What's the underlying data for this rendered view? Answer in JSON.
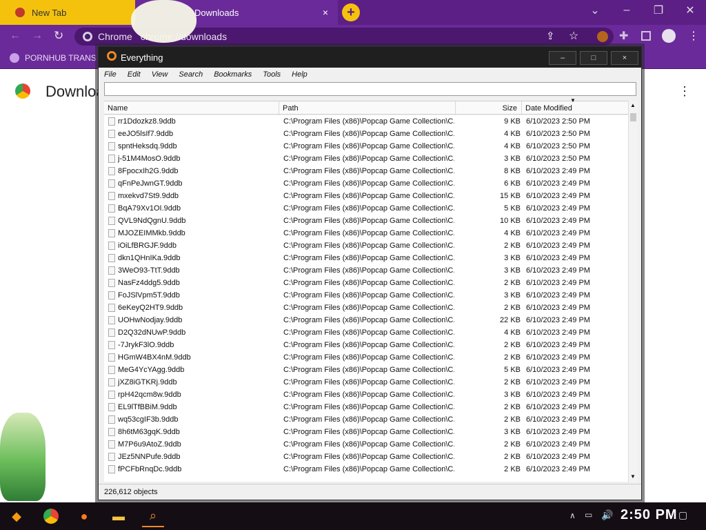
{
  "browser": {
    "tabs": [
      {
        "label": "New Tab"
      },
      {
        "label": "Downloads"
      }
    ],
    "new_tab_symbol": "+",
    "omnibox": {
      "site_label": "Chrome",
      "url_text": "chrome://downloads"
    },
    "bookmarks": [
      {
        "label": "PORNHUB TRANS"
      }
    ],
    "page_title": "Downloads",
    "colors": {
      "tabbar": "#5c1f86",
      "toolbar": "#6b2a99",
      "active_tab": "#ffffff",
      "new_tab_button": "#f4c20d"
    }
  },
  "everything": {
    "title": "Everything",
    "window_buttons": [
      "–",
      "□",
      "×"
    ],
    "menu": [
      "File",
      "Edit",
      "View",
      "Search",
      "Bookmarks",
      "Tools",
      "Help"
    ],
    "search_value": "",
    "columns": {
      "name": "Name",
      "path": "Path",
      "size": "Size",
      "date": "Date Modified"
    },
    "rows": [
      {
        "name": "rr1Ddozkz8.9ddb",
        "path": "C:\\Program Files (x86)\\Popcap Game Collection\\C...",
        "size": "9 KB",
        "date": "6/10/2023 2:50 PM"
      },
      {
        "name": "eeJO5lsIf7.9ddb",
        "path": "C:\\Program Files (x86)\\Popcap Game Collection\\C...",
        "size": "4 KB",
        "date": "6/10/2023 2:50 PM"
      },
      {
        "name": "spntHeksdq.9ddb",
        "path": "C:\\Program Files (x86)\\Popcap Game Collection\\C...",
        "size": "4 KB",
        "date": "6/10/2023 2:50 PM"
      },
      {
        "name": "j-51M4MosO.9ddb",
        "path": "C:\\Program Files (x86)\\Popcap Game Collection\\C...",
        "size": "3 KB",
        "date": "6/10/2023 2:50 PM"
      },
      {
        "name": "8FpocxIh2G.9ddb",
        "path": "C:\\Program Files (x86)\\Popcap Game Collection\\C...",
        "size": "8 KB",
        "date": "6/10/2023 2:49 PM"
      },
      {
        "name": "qFnPeJwnGT.9ddb",
        "path": "C:\\Program Files (x86)\\Popcap Game Collection\\C...",
        "size": "6 KB",
        "date": "6/10/2023 2:49 PM"
      },
      {
        "name": "mxekvd7St9.9ddb",
        "path": "C:\\Program Files (x86)\\Popcap Game Collection\\C...",
        "size": "15 KB",
        "date": "6/10/2023 2:49 PM"
      },
      {
        "name": "BqA79Xv1OI.9ddb",
        "path": "C:\\Program Files (x86)\\Popcap Game Collection\\C...",
        "size": "5 KB",
        "date": "6/10/2023 2:49 PM"
      },
      {
        "name": "QVL9NdQgnU.9ddb",
        "path": "C:\\Program Files (x86)\\Popcap Game Collection\\C...",
        "size": "10 KB",
        "date": "6/10/2023 2:49 PM"
      },
      {
        "name": "MJOZEIMMkb.9ddb",
        "path": "C:\\Program Files (x86)\\Popcap Game Collection\\C...",
        "size": "4 KB",
        "date": "6/10/2023 2:49 PM"
      },
      {
        "name": "iOiLfBRGJF.9ddb",
        "path": "C:\\Program Files (x86)\\Popcap Game Collection\\C...",
        "size": "2 KB",
        "date": "6/10/2023 2:49 PM"
      },
      {
        "name": "dkn1QHnIKa.9ddb",
        "path": "C:\\Program Files (x86)\\Popcap Game Collection\\C...",
        "size": "3 KB",
        "date": "6/10/2023 2:49 PM"
      },
      {
        "name": "3WeO93-TtT.9ddb",
        "path": "C:\\Program Files (x86)\\Popcap Game Collection\\C...",
        "size": "3 KB",
        "date": "6/10/2023 2:49 PM"
      },
      {
        "name": "NasFz4ddg5.9ddb",
        "path": "C:\\Program Files (x86)\\Popcap Game Collection\\C...",
        "size": "2 KB",
        "date": "6/10/2023 2:49 PM"
      },
      {
        "name": "FoJSlVpm5T.9ddb",
        "path": "C:\\Program Files (x86)\\Popcap Game Collection\\C...",
        "size": "3 KB",
        "date": "6/10/2023 2:49 PM"
      },
      {
        "name": "6eKeyQ2HT9.9ddb",
        "path": "C:\\Program Files (x86)\\Popcap Game Collection\\C...",
        "size": "2 KB",
        "date": "6/10/2023 2:49 PM"
      },
      {
        "name": "UOHwNodjay.9ddb",
        "path": "C:\\Program Files (x86)\\Popcap Game Collection\\C...",
        "size": "22 KB",
        "date": "6/10/2023 2:49 PM"
      },
      {
        "name": "D2Q32dNUwP.9ddb",
        "path": "C:\\Program Files (x86)\\Popcap Game Collection\\C...",
        "size": "4 KB",
        "date": "6/10/2023 2:49 PM"
      },
      {
        "name": "-7JrykF3lO.9ddb",
        "path": "C:\\Program Files (x86)\\Popcap Game Collection\\C...",
        "size": "2 KB",
        "date": "6/10/2023 2:49 PM"
      },
      {
        "name": "HGmW4BX4nM.9ddb",
        "path": "C:\\Program Files (x86)\\Popcap Game Collection\\C...",
        "size": "2 KB",
        "date": "6/10/2023 2:49 PM"
      },
      {
        "name": "MeG4YcYAgg.9ddb",
        "path": "C:\\Program Files (x86)\\Popcap Game Collection\\C...",
        "size": "5 KB",
        "date": "6/10/2023 2:49 PM"
      },
      {
        "name": "jXZ8iGTKRj.9ddb",
        "path": "C:\\Program Files (x86)\\Popcap Game Collection\\C...",
        "size": "2 KB",
        "date": "6/10/2023 2:49 PM"
      },
      {
        "name": "rpH42qcm8w.9ddb",
        "path": "C:\\Program Files (x86)\\Popcap Game Collection\\C...",
        "size": "3 KB",
        "date": "6/10/2023 2:49 PM"
      },
      {
        "name": "EL9lTfBBiM.9ddb",
        "path": "C:\\Program Files (x86)\\Popcap Game Collection\\C...",
        "size": "2 KB",
        "date": "6/10/2023 2:49 PM"
      },
      {
        "name": "wq53cgIF3b.9ddb",
        "path": "C:\\Program Files (x86)\\Popcap Game Collection\\C...",
        "size": "2 KB",
        "date": "6/10/2023 2:49 PM"
      },
      {
        "name": "8h6tM63gqK.9ddb",
        "path": "C:\\Program Files (x86)\\Popcap Game Collection\\C...",
        "size": "3 KB",
        "date": "6/10/2023 2:49 PM"
      },
      {
        "name": "M7P6u9AtoZ.9ddb",
        "path": "C:\\Program Files (x86)\\Popcap Game Collection\\C...",
        "size": "2 KB",
        "date": "6/10/2023 2:49 PM"
      },
      {
        "name": "JEz5NNPufe.9ddb",
        "path": "C:\\Program Files (x86)\\Popcap Game Collection\\C...",
        "size": "2 KB",
        "date": "6/10/2023 2:49 PM"
      },
      {
        "name": "fPCFbRnqDc.9ddb",
        "path": "C:\\Program Files (x86)\\Popcap Game Collection\\C...",
        "size": "2 KB",
        "date": "6/10/2023 2:49 PM"
      }
    ],
    "status_text": "226,612 objects"
  },
  "taskbar": {
    "clock": "2:50 PM",
    "icons": [
      "app-icon",
      "chrome-icon",
      "firefox-icon",
      "file-explorer-icon",
      "everything-icon"
    ]
  }
}
